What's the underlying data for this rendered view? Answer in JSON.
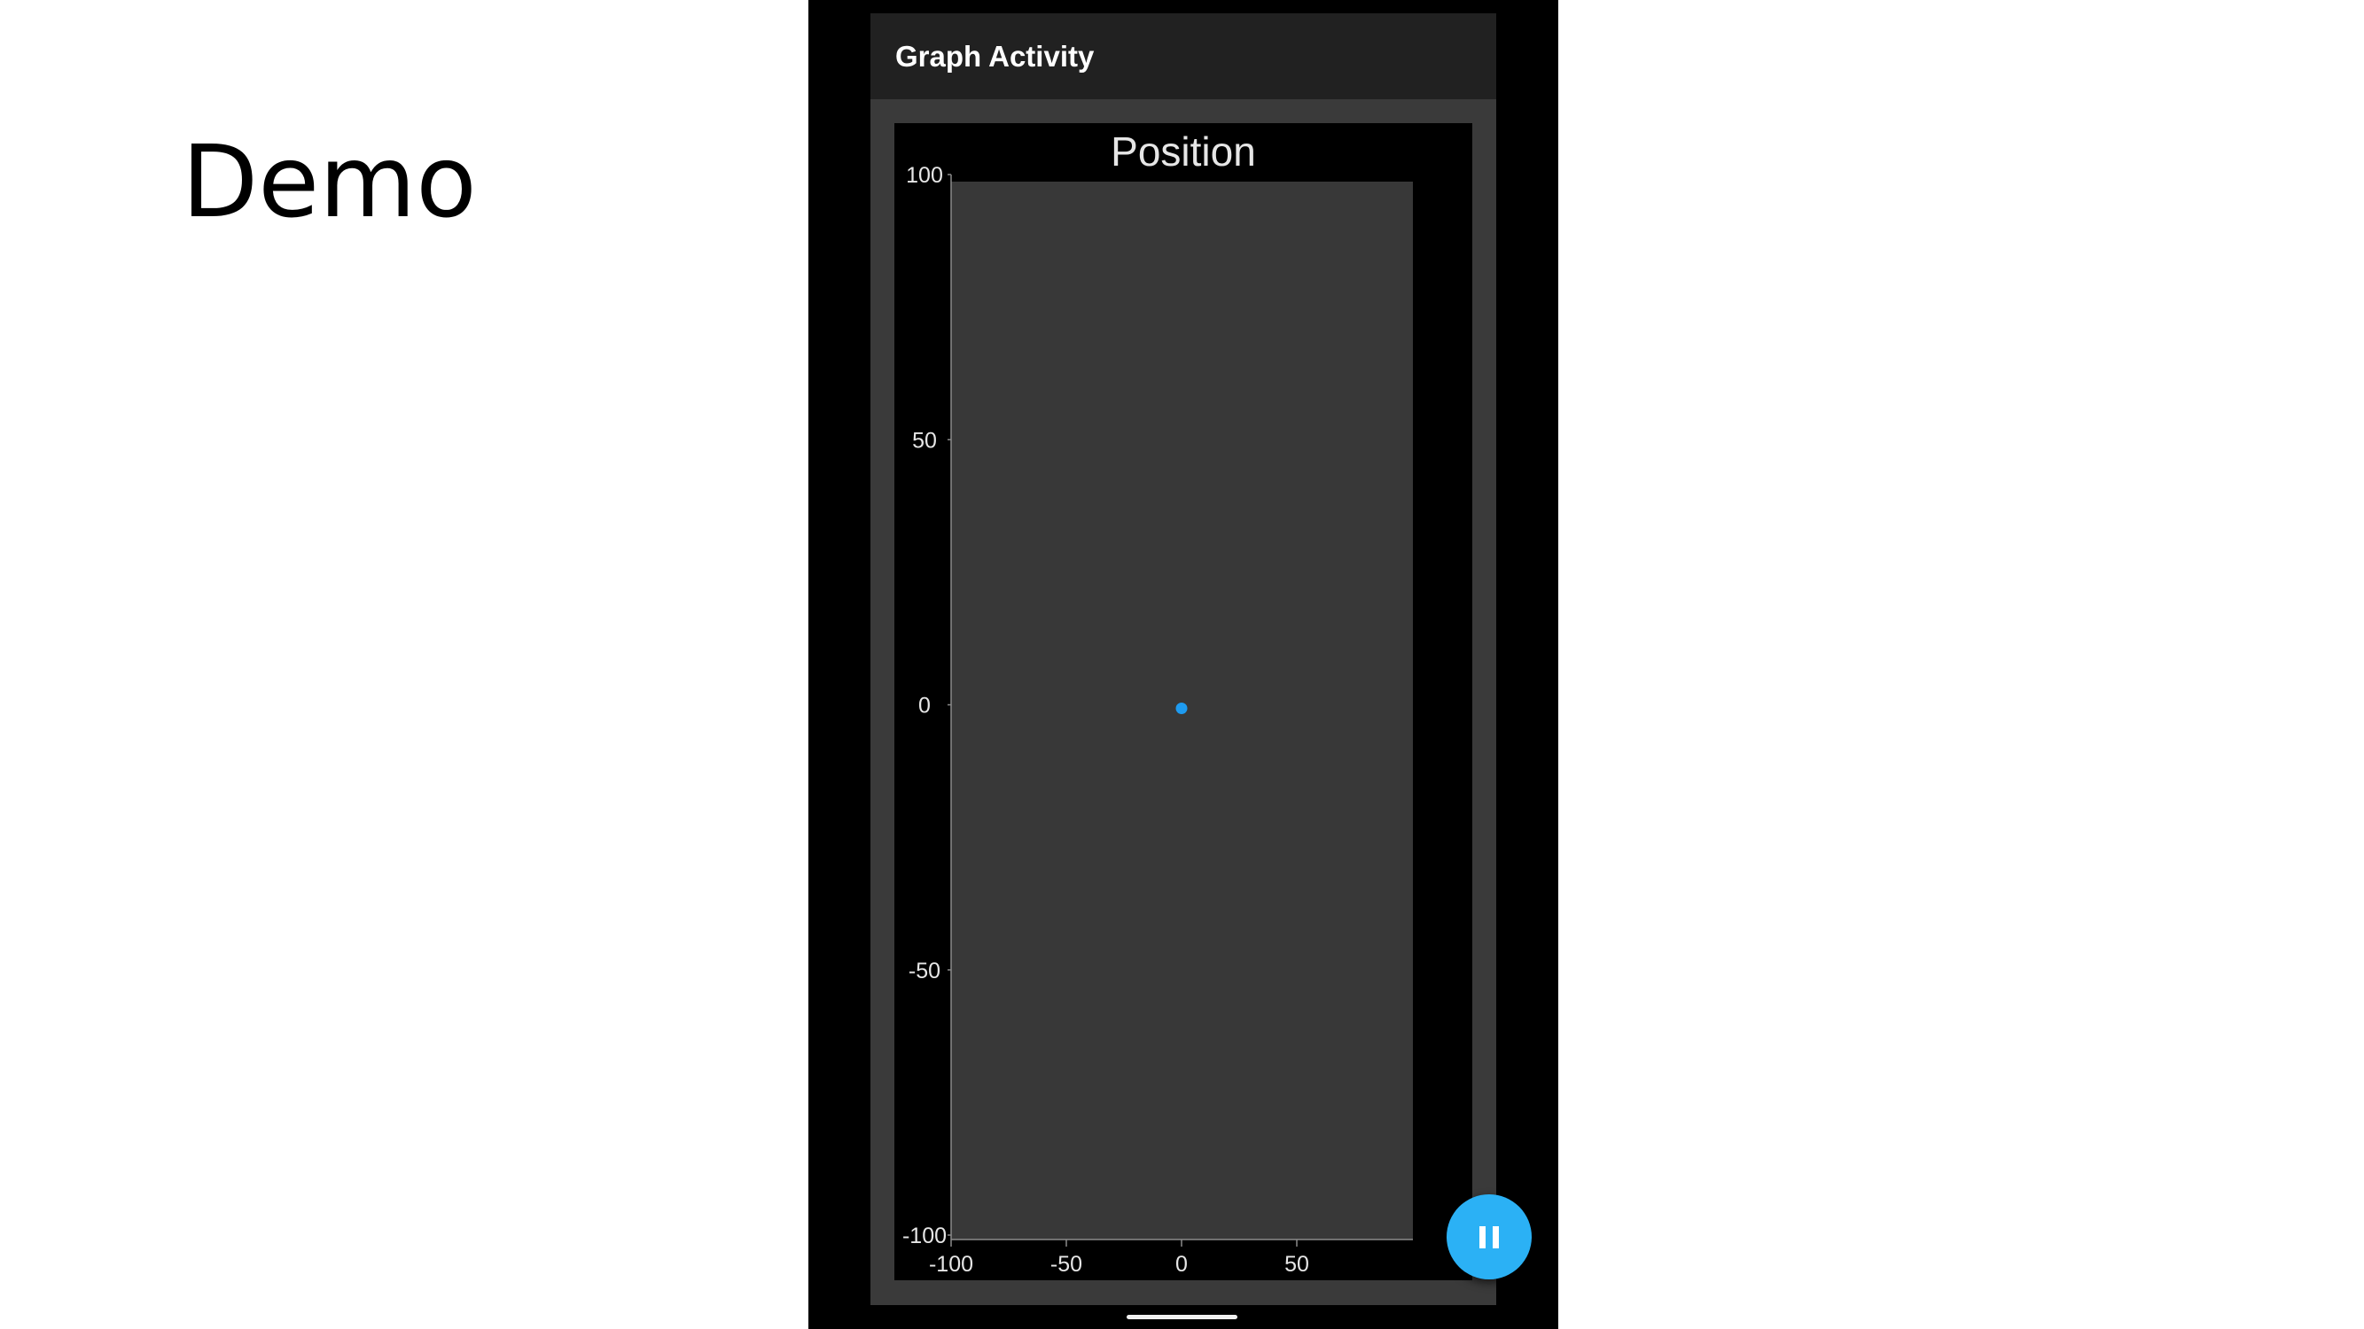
{
  "slide": {
    "title": "Demo"
  },
  "app": {
    "title": "Graph Activity"
  },
  "fab": {
    "icon": "pause-icon",
    "color": "#2bb1f5"
  },
  "colors": {
    "plot_background": "#383838",
    "point": "#1e9bf0",
    "card_background": "#000000",
    "appbar": "#212121"
  },
  "chart_data": {
    "type": "scatter",
    "title": "Position",
    "xlabel": "",
    "ylabel": "",
    "xlim": [
      -100,
      100
    ],
    "ylim": [
      -100,
      100
    ],
    "x_ticks": [
      -100,
      -50,
      0,
      50
    ],
    "x_tick_labels": [
      "-100",
      "-50",
      "0",
      "50"
    ],
    "y_ticks": [
      100,
      50,
      0,
      -50,
      -100
    ],
    "y_tick_labels": [
      "100",
      "50",
      "0",
      "-50",
      "-100"
    ],
    "grid": false,
    "series": [
      {
        "points": [
          {
            "x": 0,
            "y": 0
          }
        ]
      }
    ]
  }
}
